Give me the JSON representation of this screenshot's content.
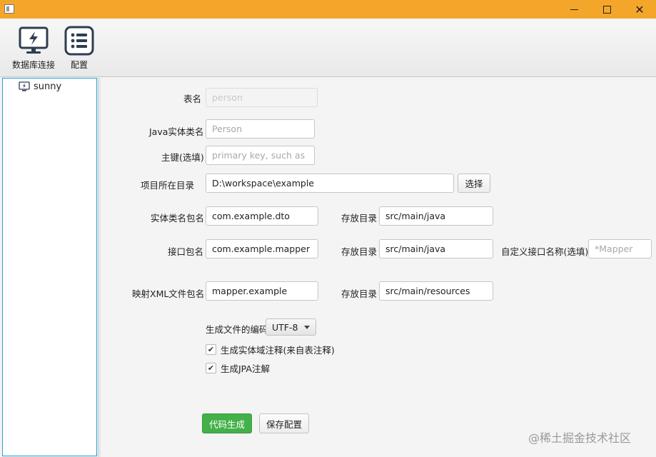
{
  "toolbar": {
    "db_connect_label": "数据库连接",
    "config_label": "配置",
    "db_connect_icon": "monitor-lightning-icon",
    "config_icon": "list-icon"
  },
  "tree": {
    "items": [
      {
        "label": "sunny",
        "icon": "database-connection-icon"
      }
    ]
  },
  "form": {
    "table_name": {
      "label": "表名",
      "placeholder": "person",
      "value": ""
    },
    "entity_class": {
      "label": "Java实体类名",
      "placeholder": "Person",
      "value": ""
    },
    "primary_key": {
      "label": "主键(选填)",
      "placeholder": "primary key, such as id",
      "value": ""
    },
    "project_dir": {
      "label": "项目所在目录",
      "value": "D:\\workspace\\example",
      "button": "选择"
    },
    "entity_package": {
      "label": "实体类名包名",
      "value": "com.example.dto",
      "dir_label": "存放目录",
      "dir_value": "src/main/java"
    },
    "interface_package": {
      "label": "接口包名",
      "value": "com.example.mapper",
      "dir_label": "存放目录",
      "dir_value": "src/main/java",
      "custom_label": "自定义接口名称(选填)",
      "custom_placeholder": "*Mapper"
    },
    "xml_package": {
      "label": "映射XML文件包名",
      "value": "mapper.example",
      "dir_label": "存放目录",
      "dir_value": "src/main/resources"
    },
    "encoding": {
      "label": "生成文件的编码",
      "value": "UTF-8"
    },
    "comment_check": {
      "label": "生成实体域注释(来自表注释)",
      "checked": true
    },
    "jpa_check": {
      "label": "生成JPA注解",
      "checked": true
    },
    "generate_button": "代码生成",
    "save_button": "保存配置"
  },
  "colors": {
    "titlebar": "#f4a62a",
    "panel_border": "#2a9fd6",
    "generate_button": "#43b04a"
  },
  "watermark": "@稀土掘金技术社区"
}
